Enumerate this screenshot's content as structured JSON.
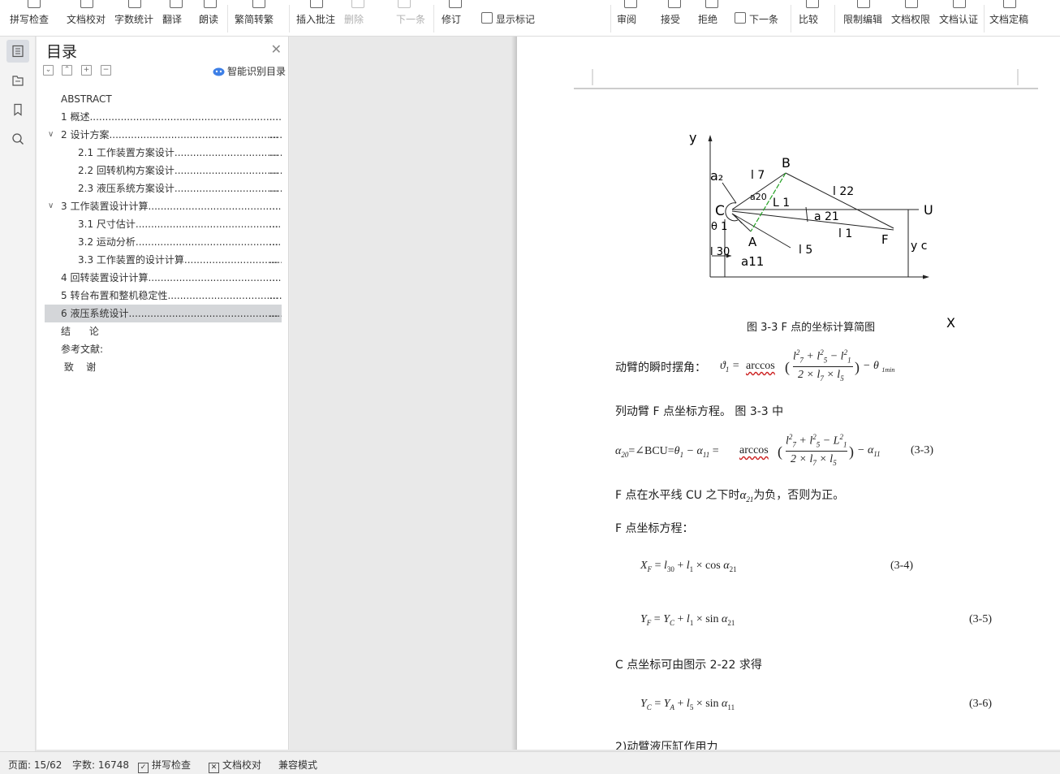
{
  "ribbon": {
    "spell_check": "拼写检查",
    "doc_proof": "文档校对",
    "word_count": "字数统计",
    "translate": "翻译",
    "read_aloud": "朗读",
    "trad_simp": "繁简转繁",
    "insert_comment": "插入批注",
    "delete": "删除",
    "next_comment": "下一条",
    "revise": "修订",
    "show_marks": "显示标记",
    "review": "审阅",
    "accept": "接受",
    "reject": "拒绝",
    "next_change": "下一条",
    "compare": "比较",
    "restrict_edit": "限制编辑",
    "doc_permission": "文档权限",
    "doc_auth": "文档认证",
    "doc_finalize": "文档定稿"
  },
  "toc": {
    "title": "目录",
    "smart": "智能识别目录",
    "items": [
      {
        "label": "ABSTRACT",
        "dots": ""
      },
      {
        "label": "1  概述.......................................................................",
        "dots": "..."
      },
      {
        "label": "2  设计方案...................................................................",
        "dots": "..."
      },
      {
        "label": "2.1  工作装置方案设计.................................................",
        "dots": "..."
      },
      {
        "label": "2.2  回转机构方案设计.................................................",
        "dots": "..."
      },
      {
        "label": "2.3  液压系统方案设计.................................................",
        "dots": "..."
      },
      {
        "label": "3  工作装置设计计算.......................................................",
        "dots": "..."
      },
      {
        "label": "3.1  尺寸估计.............................................................",
        "dots": "..."
      },
      {
        "label": "3.2  运动分析.............................................................",
        "dots": "..."
      },
      {
        "label": "3.3  工作装置的设计计算...............................................",
        "dots": "..."
      },
      {
        "label": "4  回转装置设计计算.......................................................",
        "dots": "..."
      },
      {
        "label": "5  转台布置和整机稳定性...................................................",
        "dots": "..."
      },
      {
        "label": "6  液压系统设计...........................................................",
        "dots": "..."
      },
      {
        "label": "结      论",
        "dots": ""
      },
      {
        "label": "参考文献:",
        "dots": ""
      },
      {
        "label": " 致    谢",
        "dots": ""
      }
    ]
  },
  "figure": {
    "caption": "图 3-3   F 点的坐标计算简图",
    "labels": {
      "y": "y",
      "x": "X",
      "B": "B",
      "C": "C",
      "A": "A",
      "F": "F",
      "U": "U",
      "a2": "a₂",
      "l7": "l 7",
      "a20": "a20",
      "L1": "L 1",
      "l22": "l 22",
      "a21": "a 21",
      "l1": "l 1",
      "theta1": "θ 1",
      "l5": "l 5",
      "l30": "l 30",
      "a11": "a11",
      "yc": "y c"
    }
  },
  "doc": {
    "p1": "动臂的瞬时摆角：",
    "p2": "列动臂 F 点坐标方程。 图 3-3 中",
    "p3": "F 点在水平线 CU 之下时",
    "p3b": "为负，否则为正。",
    "p4": "F 点坐标方程：",
    "p5": "C 点坐标可由图示 2-22 求得",
    "p6": "2)动臂液压缸作用力",
    "eq33": "(3-3)",
    "eq34": "(3-4)",
    "eq35": "(3-5)",
    "eq36": "(3-6)"
  },
  "status": {
    "page": "页面: 15/62",
    "words": "字数: 16748",
    "spell": "拼写检查",
    "proof": "文档校对",
    "compat": "兼容模式"
  }
}
